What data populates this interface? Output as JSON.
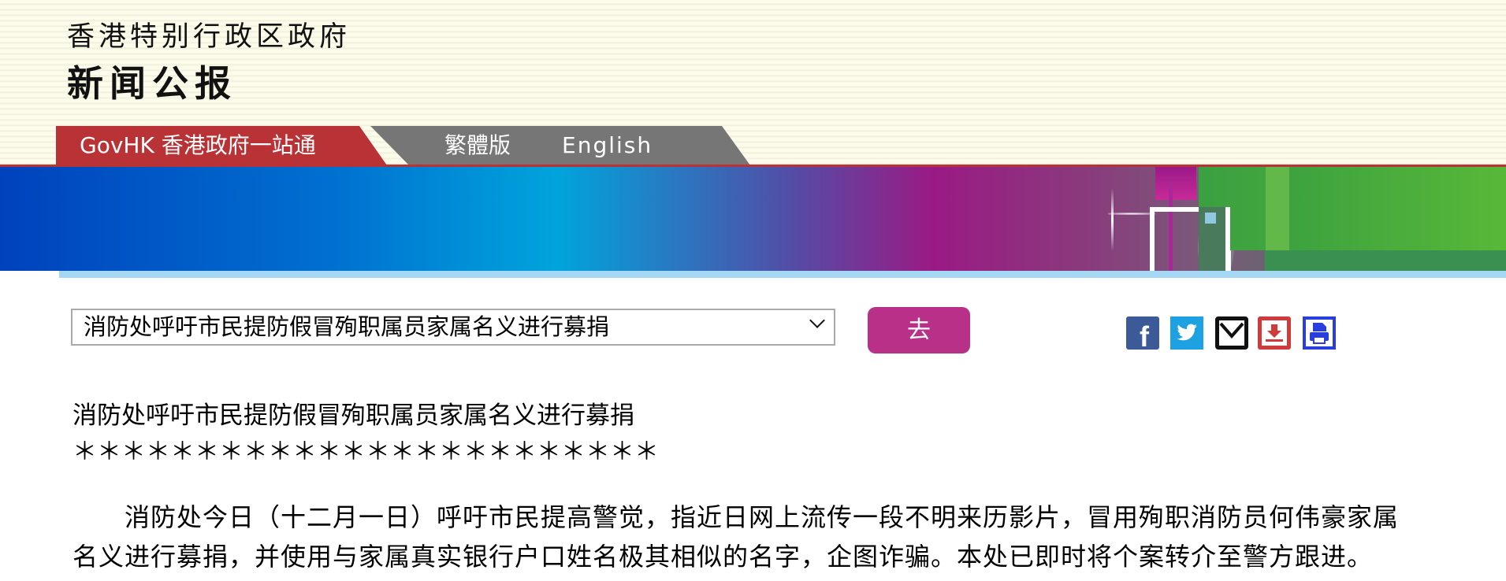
{
  "header": {
    "government": "香港特别行政区政府",
    "section": "新闻公报"
  },
  "nav": {
    "govhk": "GovHK 香港政府一站通",
    "traditional": "繁體版",
    "english": "English"
  },
  "toolbar": {
    "selected_article": "消防处呼吁市民提防假冒殉职属员家属名义进行募捐",
    "go_label": "去",
    "share_icons": [
      "facebook-icon",
      "twitter-icon",
      "email-icon",
      "download-icon",
      "print-icon"
    ]
  },
  "article": {
    "title": "消防处呼吁市民提防假冒殉职属员家属名义进行募捐",
    "separator": "＊＊＊＊＊＊＊＊＊＊＊＊＊＊＊＊＊＊＊＊＊＊＊＊",
    "paragraph": "消防处今日（十二月一日）呼吁市民提高警觉，指近日网上流传一段不明来历影片，冒用殉职消防员何伟豪家属名义进行募捐，并使用与家属真实银行户口姓名极其相似的名字，企图诈骗。本处已即时将个案转介至警方跟进。"
  },
  "colors": {
    "red": "#b83236",
    "grey": "#767676",
    "go_button": "#b83087",
    "light_blue": "#a4d8f4"
  }
}
